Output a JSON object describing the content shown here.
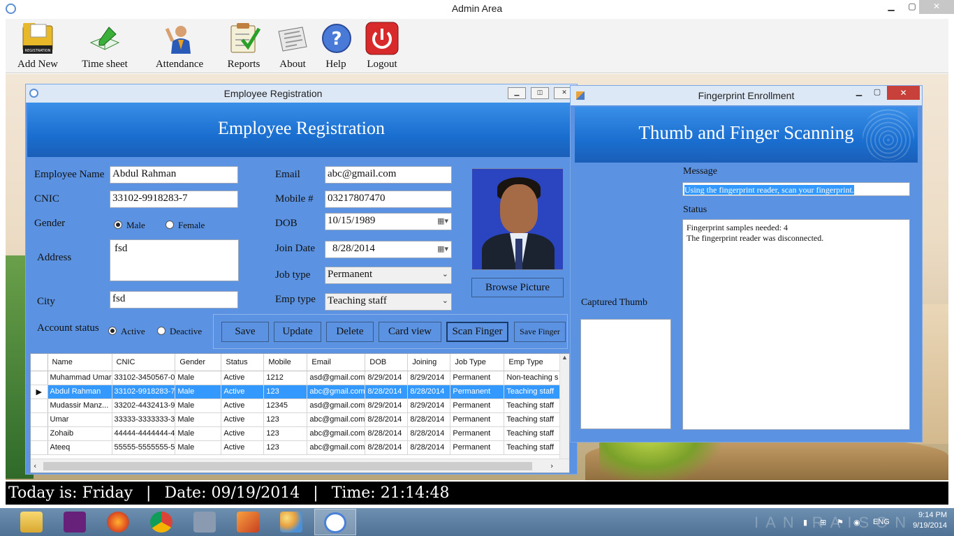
{
  "app": {
    "title": "Admin Area"
  },
  "window_controls": {
    "minimize": "▁",
    "maximize": "▢",
    "close": "✕"
  },
  "toolbar": {
    "items": [
      {
        "label": "Add New",
        "icon": "registration-folder-icon"
      },
      {
        "label": "Time sheet",
        "icon": "book-pen-icon"
      },
      {
        "label": "Attendance",
        "icon": "person-raising-hand-icon"
      },
      {
        "label": "Reports",
        "icon": "checklist-icon"
      },
      {
        "label": "About",
        "icon": "newspaper-icon"
      },
      {
        "label": "Help",
        "icon": "help-question-icon"
      },
      {
        "label": "Logout",
        "icon": "power-icon"
      }
    ],
    "registration_icon_text": "REGISTRATION"
  },
  "registration": {
    "window_title": "Employee Registration",
    "header": "Employee Registration",
    "labels": {
      "name": "Employee Name",
      "cnic": "CNIC",
      "gender": "Gender",
      "address": "Address",
      "city": "City",
      "account_status": "Account status",
      "email": "Email",
      "mobile": "Mobile #",
      "dob": "DOB",
      "join_date": "Join Date",
      "job_type": "Job type",
      "emp_type": "Emp type"
    },
    "values": {
      "name": "Abdul Rahman",
      "cnic": "33102-9918283-7",
      "address": "fsd",
      "city": "fsd",
      "email": "abc@gmail.com",
      "mobile": "03217807470",
      "dob": "10/15/1989",
      "join_date": "8/28/2014",
      "job_type": "Permanent",
      "emp_type": "Teaching staff"
    },
    "gender_options": {
      "male": "Male",
      "female": "Female",
      "selected": "male"
    },
    "status_options": {
      "active": "Active",
      "deactive": "Deactive",
      "selected": "active"
    },
    "buttons": {
      "browse": "Browse Picture",
      "save": "Save",
      "update": "Update",
      "delete": "Delete",
      "card_view": "Card view",
      "scan_finger": "Scan Finger",
      "save_finger": "Save Finger"
    },
    "grid": {
      "columns": [
        "Name",
        "CNIC",
        "Gender",
        "Status",
        "Mobile",
        "Email",
        "DOB",
        "Joining",
        "Job Type",
        "Emp Type"
      ],
      "rows": [
        [
          "Muhammad Umar",
          "33102-3450567-0",
          "Male",
          "Active",
          "1212",
          "asd@gmail.com",
          "8/29/2014",
          "8/29/2014",
          "Permanent",
          "Non-teaching s"
        ],
        [
          "Abdul Rahman",
          "33102-9918283-7",
          "Male",
          "Active",
          "123",
          "abc@gmail.com",
          "8/28/2014",
          "8/28/2014",
          "Permanent",
          "Teaching staff"
        ],
        [
          "Mudassir Manz...",
          "33202-4432413-9",
          "Male",
          "Active",
          "12345",
          "asd@gmail.com",
          "8/29/2014",
          "8/29/2014",
          "Permanent",
          "Teaching staff"
        ],
        [
          "Umar",
          "33333-3333333-3",
          "Male",
          "Active",
          "123",
          "abc@gmail.com",
          "8/28/2014",
          "8/28/2014",
          "Permanent",
          "Teaching staff"
        ],
        [
          "Zohaib",
          "44444-4444444-4",
          "Male",
          "Active",
          "123",
          "abc@gmail.com",
          "8/28/2014",
          "8/28/2014",
          "Permanent",
          "Teaching staff"
        ],
        [
          "Ateeq",
          "55555-5555555-5",
          "Male",
          "Active",
          "123",
          "abc@gmail.com",
          "8/28/2014",
          "8/28/2014",
          "Permanent",
          "Teaching staff"
        ]
      ],
      "selected_row": 1
    }
  },
  "fingerprint": {
    "window_title": "Fingerprint Enrollment",
    "header": "Thumb and Finger Scanning",
    "message_label": "Message",
    "message": "Using the fingerprint reader, scan your fingerprint.",
    "status_label": "Status",
    "status_lines": [
      "Fingerprint samples needed: 4",
      "The fingerprint reader was disconnected."
    ],
    "captured_label": "Captured Thumb"
  },
  "statusbar": {
    "day_label": "Today is:",
    "day": "Friday",
    "date_label": "Date:",
    "date": "09/19/2014",
    "time_label": "Time:",
    "time": "21:14:48",
    "separator": "|"
  },
  "taskbar": {
    "items": [
      "file-explorer-icon",
      "visual-studio-icon",
      "firefox-icon",
      "chrome-icon",
      "evo-app-icon",
      "sublime-icon",
      "paint-icon",
      "clock-app-icon"
    ],
    "language": "ENG",
    "clock_time": "9:14 PM",
    "clock_date": "9/19/2014"
  },
  "colors": {
    "form_bg": "#5b93e2",
    "header_blue": "#1a6fd0",
    "selection": "#3399ff",
    "close_red": "#c7403a"
  }
}
